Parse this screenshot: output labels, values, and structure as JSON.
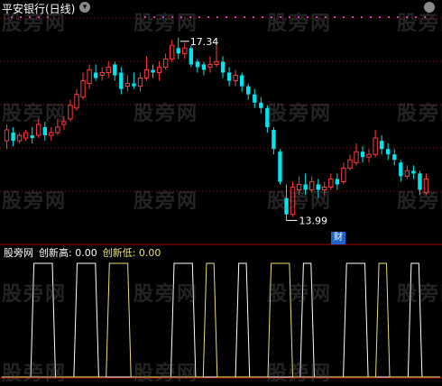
{
  "main_title": "平安银行(日线)",
  "watermark": "股旁网",
  "high_label": "17.34",
  "low_label": "13.99",
  "finance_badge": "财",
  "indicator": {
    "name": "股旁网",
    "hi_label": "创新高: 0.00",
    "lo_label": "创新低: 0.00"
  },
  "colors": {
    "up": "#ff3b3b",
    "down": "#00e5ee",
    "grid": "#7a1e1e",
    "line": "#ffffff",
    "line2": "#e8e070",
    "separator": "#b00000"
  },
  "chart_data": {
    "type": "candlestick",
    "y_range": [
      13.6,
      17.7
    ],
    "max_price": 17.34,
    "min_price": 13.99,
    "candles": [
      {
        "o": 15.45,
        "c": 15.65,
        "h": 15.75,
        "l": 15.3
      },
      {
        "o": 15.6,
        "c": 15.45,
        "h": 15.7,
        "l": 15.35
      },
      {
        "o": 15.45,
        "c": 15.55,
        "h": 15.6,
        "l": 15.4
      },
      {
        "o": 15.5,
        "c": 15.6,
        "h": 15.65,
        "l": 15.45
      },
      {
        "o": 15.55,
        "c": 15.5,
        "h": 15.7,
        "l": 15.4
      },
      {
        "o": 15.55,
        "c": 15.75,
        "h": 15.85,
        "l": 15.5
      },
      {
        "o": 15.7,
        "c": 15.55,
        "h": 15.8,
        "l": 15.45
      },
      {
        "o": 15.55,
        "c": 15.6,
        "h": 15.7,
        "l": 15.45
      },
      {
        "o": 15.6,
        "c": 15.7,
        "h": 15.85,
        "l": 15.55
      },
      {
        "o": 15.75,
        "c": 15.8,
        "h": 15.9,
        "l": 15.65
      },
      {
        "o": 15.85,
        "c": 16.1,
        "h": 16.2,
        "l": 15.8
      },
      {
        "o": 16.05,
        "c": 16.3,
        "h": 16.4,
        "l": 16.0
      },
      {
        "o": 16.25,
        "c": 16.55,
        "h": 16.7,
        "l": 16.2
      },
      {
        "o": 16.5,
        "c": 16.75,
        "h": 16.85,
        "l": 16.4
      },
      {
        "o": 16.7,
        "c": 16.6,
        "h": 16.85,
        "l": 16.55
      },
      {
        "o": 16.65,
        "c": 16.7,
        "h": 16.8,
        "l": 16.55
      },
      {
        "o": 16.7,
        "c": 16.8,
        "h": 16.9,
        "l": 16.6
      },
      {
        "o": 16.85,
        "c": 16.65,
        "h": 16.9,
        "l": 16.55
      },
      {
        "o": 16.7,
        "c": 16.4,
        "h": 16.8,
        "l": 16.3
      },
      {
        "o": 16.45,
        "c": 16.5,
        "h": 16.65,
        "l": 16.35
      },
      {
        "o": 16.5,
        "c": 16.45,
        "h": 16.7,
        "l": 16.4
      },
      {
        "o": 16.45,
        "c": 16.6,
        "h": 16.7,
        "l": 16.35
      },
      {
        "o": 16.6,
        "c": 16.75,
        "h": 17.0,
        "l": 16.55
      },
      {
        "o": 16.75,
        "c": 16.7,
        "h": 16.85,
        "l": 16.6
      },
      {
        "o": 16.7,
        "c": 16.8,
        "h": 16.9,
        "l": 16.55
      },
      {
        "o": 16.8,
        "c": 16.95,
        "h": 17.05,
        "l": 16.75
      },
      {
        "o": 16.95,
        "c": 17.2,
        "h": 17.3,
        "l": 16.9
      },
      {
        "o": 17.15,
        "c": 17.05,
        "h": 17.34,
        "l": 16.95
      },
      {
        "o": 17.05,
        "c": 17.15,
        "h": 17.25,
        "l": 16.95
      },
      {
        "o": 17.15,
        "c": 16.85,
        "h": 17.2,
        "l": 16.8
      },
      {
        "o": 16.9,
        "c": 16.8,
        "h": 16.95,
        "l": 16.7
      },
      {
        "o": 16.85,
        "c": 16.75,
        "h": 16.9,
        "l": 16.65
      },
      {
        "o": 16.8,
        "c": 16.85,
        "h": 17.0,
        "l": 16.7
      },
      {
        "o": 16.85,
        "c": 16.9,
        "h": 17.2,
        "l": 16.8
      },
      {
        "o": 16.9,
        "c": 16.7,
        "h": 17.0,
        "l": 16.6
      },
      {
        "o": 16.7,
        "c": 16.55,
        "h": 16.8,
        "l": 16.45
      },
      {
        "o": 16.55,
        "c": 16.65,
        "h": 16.75,
        "l": 16.45
      },
      {
        "o": 16.65,
        "c": 16.45,
        "h": 16.7,
        "l": 16.35
      },
      {
        "o": 16.45,
        "c": 16.3,
        "h": 16.5,
        "l": 16.2
      },
      {
        "o": 16.3,
        "c": 16.15,
        "h": 16.4,
        "l": 16.05
      },
      {
        "o": 16.15,
        "c": 16.05,
        "h": 16.25,
        "l": 15.95
      },
      {
        "o": 16.05,
        "c": 15.7,
        "h": 16.1,
        "l": 15.6
      },
      {
        "o": 15.65,
        "c": 15.3,
        "h": 15.7,
        "l": 15.2
      },
      {
        "o": 15.25,
        "c": 14.7,
        "h": 15.3,
        "l": 14.65
      },
      {
        "o": 14.4,
        "c": 14.1,
        "h": 14.65,
        "l": 13.99
      },
      {
        "o": 14.1,
        "c": 14.6,
        "h": 14.7,
        "l": 14.05
      },
      {
        "o": 14.55,
        "c": 14.65,
        "h": 14.8,
        "l": 14.45
      },
      {
        "o": 14.65,
        "c": 14.55,
        "h": 14.85,
        "l": 14.45
      },
      {
        "o": 14.55,
        "c": 14.7,
        "h": 14.8,
        "l": 14.5
      },
      {
        "o": 14.65,
        "c": 14.55,
        "h": 14.75,
        "l": 14.4
      },
      {
        "o": 14.55,
        "c": 14.6,
        "h": 14.7,
        "l": 14.45
      },
      {
        "o": 14.6,
        "c": 14.75,
        "h": 14.85,
        "l": 14.55
      },
      {
        "o": 14.75,
        "c": 14.65,
        "h": 14.85,
        "l": 14.55
      },
      {
        "o": 14.7,
        "c": 14.95,
        "h": 15.05,
        "l": 14.65
      },
      {
        "o": 14.95,
        "c": 15.1,
        "h": 15.2,
        "l": 14.9
      },
      {
        "o": 15.05,
        "c": 15.25,
        "h": 15.4,
        "l": 15.0
      },
      {
        "o": 15.25,
        "c": 15.15,
        "h": 15.35,
        "l": 15.05
      },
      {
        "o": 15.15,
        "c": 15.2,
        "h": 15.3,
        "l": 15.05
      },
      {
        "o": 15.2,
        "c": 15.5,
        "h": 15.65,
        "l": 15.15
      },
      {
        "o": 15.45,
        "c": 15.3,
        "h": 15.55,
        "l": 15.2
      },
      {
        "o": 15.3,
        "c": 15.2,
        "h": 15.4,
        "l": 15.1
      },
      {
        "o": 15.2,
        "c": 15.1,
        "h": 15.3,
        "l": 15.0
      },
      {
        "o": 15.05,
        "c": 14.8,
        "h": 15.1,
        "l": 14.7
      },
      {
        "o": 14.8,
        "c": 14.9,
        "h": 15.0,
        "l": 14.75
      },
      {
        "o": 14.9,
        "c": 14.85,
        "h": 15.0,
        "l": 14.75
      },
      {
        "o": 14.85,
        "c": 14.55,
        "h": 14.9,
        "l": 14.45
      },
      {
        "o": 14.5,
        "c": 14.75,
        "h": 14.85,
        "l": 14.45
      }
    ],
    "signal_high": [
      0,
      0,
      0,
      1,
      1,
      0,
      0,
      1,
      1,
      0,
      0,
      0,
      0,
      0,
      0,
      0,
      1,
      1,
      0,
      0,
      0,
      0,
      1,
      0,
      0,
      0,
      0,
      0,
      1,
      0,
      0,
      0,
      1,
      1,
      0,
      0,
      0,
      0,
      1,
      0,
      0
    ],
    "signal_low": [
      0,
      0,
      0,
      0,
      0,
      0,
      0,
      0,
      0,
      0,
      1,
      1,
      0,
      0,
      0,
      0,
      0,
      0,
      0,
      1,
      0,
      0,
      0,
      0,
      0,
      1,
      1,
      0,
      0,
      0,
      0,
      0,
      0,
      0,
      0,
      1,
      0,
      0,
      0,
      0,
      0
    ]
  }
}
